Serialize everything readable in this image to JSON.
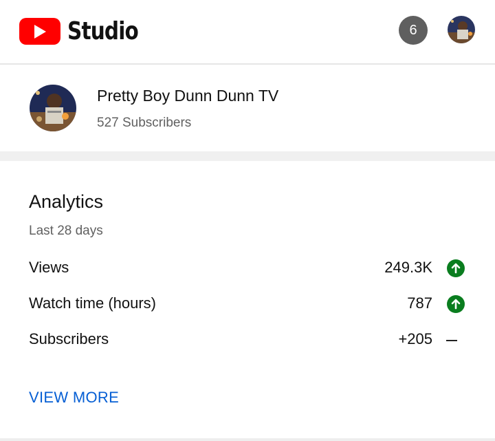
{
  "header": {
    "brand_label": "Studio",
    "notification_count": "6",
    "icons": {
      "logo": "youtube-play-icon",
      "account": "account-avatar"
    }
  },
  "channel": {
    "name": "Pretty Boy Dunn Dunn TV",
    "subscribers": "527 Subscribers"
  },
  "analytics": {
    "title": "Analytics",
    "period": "Last 28 days",
    "metrics": [
      {
        "label": "Views",
        "value": "249.3K",
        "trend": "up"
      },
      {
        "label": "Watch time (hours)",
        "value": "787",
        "trend": "up"
      },
      {
        "label": "Subscribers",
        "value": "+205",
        "trend": "flat"
      }
    ],
    "view_more": "VIEW MORE"
  },
  "colors": {
    "brand_red": "#ff0000",
    "trend_up_green": "#0a7d1f",
    "link_blue": "#065fd4"
  }
}
